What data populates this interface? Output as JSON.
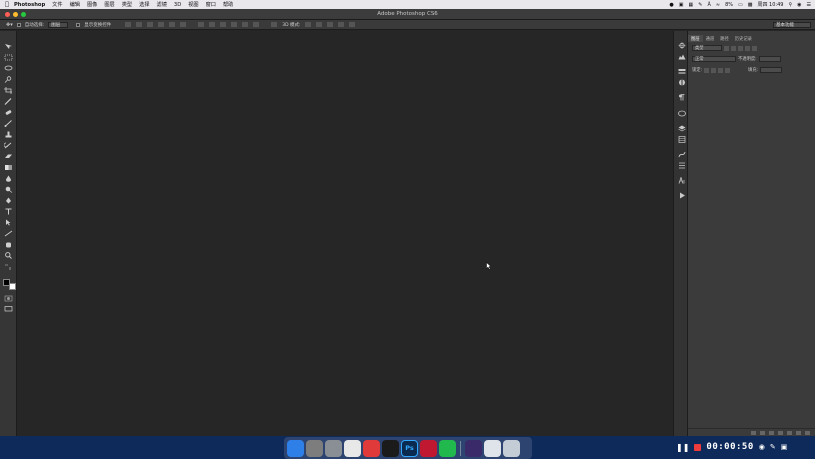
{
  "menubar": {
    "app_name": "Photoshop",
    "items": [
      "文件",
      "编辑",
      "图像",
      "图层",
      "类型",
      "选择",
      "滤镜",
      "3D",
      "视图",
      "窗口",
      "帮助"
    ],
    "battery": "8%",
    "datetime": "周四 10:49"
  },
  "window": {
    "title": "Adobe Photoshop CS6"
  },
  "options_bar": {
    "auto_select_label": "自动选择:",
    "auto_select_value": "图层",
    "show_transform_label": "显示变换控件",
    "mode_3d_label": "3D 模式:",
    "workspace": "基本功能"
  },
  "panel": {
    "tabs": [
      "图层",
      "通道",
      "路径",
      "历史记录"
    ],
    "filter_kind": "类型",
    "blend_mode": "正常",
    "opacity_label": "不透明度:",
    "lock_label": "锁定:",
    "fill_label": "填充:"
  },
  "recorder": {
    "time": "00:00:50"
  },
  "dock_apps": [
    {
      "name": "finder",
      "color": "#2f7fe8",
      "label": ""
    },
    {
      "name": "system-preferences",
      "color": "#7d7d7d",
      "label": ""
    },
    {
      "name": "launchpad",
      "color": "#8a8f96",
      "label": ""
    },
    {
      "name": "chrome",
      "color": "#e8e8e8",
      "label": ""
    },
    {
      "name": "weibo",
      "color": "#e03a3a",
      "label": ""
    },
    {
      "name": "qq",
      "color": "#1b1b1b",
      "label": ""
    },
    {
      "name": "photoshop",
      "color": "#0b2a4f",
      "label": "Ps"
    },
    {
      "name": "red-app",
      "color": "#c01830",
      "label": ""
    },
    {
      "name": "iqiyi",
      "color": "#21b84d",
      "label": ""
    },
    {
      "name": "purple-app",
      "color": "#3a2a6a",
      "label": ""
    },
    {
      "name": "preview",
      "color": "#dfe3ea",
      "label": ""
    },
    {
      "name": "trash",
      "color": "#c4ccd6",
      "label": ""
    }
  ]
}
